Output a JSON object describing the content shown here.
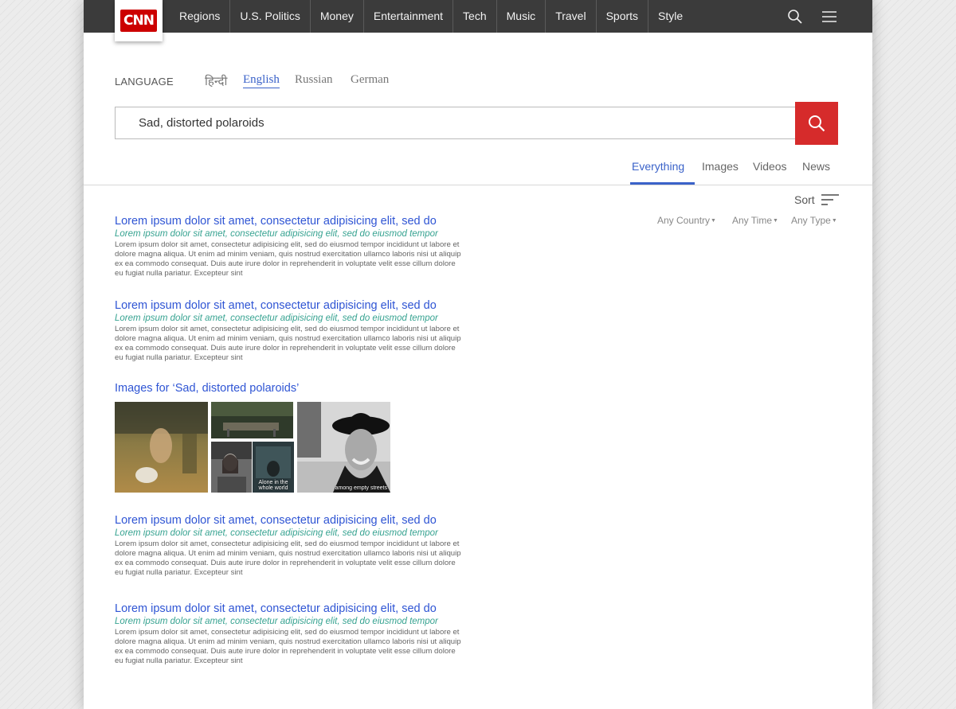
{
  "nav": {
    "logo_text": "CNN",
    "items": [
      "Regions",
      "U.S. Politics",
      "Money",
      "Entertainment",
      "Tech",
      "Music",
      "Travel",
      "Sports",
      "Style"
    ]
  },
  "language": {
    "label": "LANGUAGE",
    "options": [
      "हिन्दी",
      "English",
      "Russian",
      "German"
    ],
    "selected": "English"
  },
  "search": {
    "value": "Sad, distorted polaroids"
  },
  "tabs": {
    "items": [
      "Everything",
      "Images",
      "Videos",
      "News"
    ],
    "active": "Everything"
  },
  "sort": {
    "label": "Sort",
    "filters": [
      "Any Country",
      "Any Time",
      "Any Type"
    ]
  },
  "results": [
    {
      "title": "Lorem ipsum dolor sit amet, consectetur adipisicing elit, sed do",
      "subtitle": "Lorem ipsum dolor sit amet, consectetur adipisicing elit, sed do eiusmod tempor",
      "body": "Lorem ipsum dolor sit amet, consectetur adipisicing elit, sed do eiusmod tempor incididunt ut labore et dolore magna aliqua. Ut enim ad minim veniam, quis nostrud exercitation ullamco laboris nisi ut aliquip ex ea commodo consequat. Duis aute irure dolor in reprehenderit in voluptate velit esse cillum dolore eu fugiat nulla pariatur. Excepteur sint"
    },
    {
      "title": "Lorem ipsum dolor sit amet, consectetur adipisicing elit, sed do",
      "subtitle": "Lorem ipsum dolor sit amet, consectetur adipisicing elit, sed do eiusmod tempor",
      "body": "Lorem ipsum dolor sit amet, consectetur adipisicing elit, sed do eiusmod tempor incididunt ut labore et dolore magna aliqua. Ut enim ad minim veniam, quis nostrud exercitation ullamco laboris nisi ut aliquip ex ea commodo consequat. Duis aute irure dolor in reprehenderit in voluptate velit esse cillum dolore eu fugiat nulla pariatur. Excepteur sint"
    },
    {
      "title": "Lorem ipsum dolor sit amet, consectetur adipisicing elit, sed do",
      "subtitle": "Lorem ipsum dolor sit amet, consectetur adipisicing elit, sed do eiusmod tempor",
      "body": "Lorem ipsum dolor sit amet, consectetur adipisicing elit, sed do eiusmod tempor incididunt ut labore et dolore magna aliqua. Ut enim ad minim veniam, quis nostrud exercitation ullamco laboris nisi ut aliquip ex ea commodo consequat. Duis aute irure dolor in reprehenderit in voluptate velit esse cillum dolore eu fugiat nulla pariatur. Excepteur sint"
    },
    {
      "title": "Lorem ipsum dolor sit amet, consectetur adipisicing elit, sed do",
      "subtitle": "Lorem ipsum dolor sit amet, consectetur adipisicing elit, sed do eiusmod tempor",
      "body": "Lorem ipsum dolor sit amet, consectetur adipisicing elit, sed do eiusmod tempor incididunt ut labore et dolore magna aliqua. Ut enim ad minim veniam, quis nostrud exercitation ullamco laboris nisi ut aliquip ex ea commodo consequat. Duis aute irure dolor in reprehenderit in voluptate velit esse cillum dolore eu fugiat nulla pariatur. Excepteur sint"
    }
  ],
  "images_section": {
    "title": "Images for ‘Sad, distorted polaroids’",
    "thumbnails": [
      {
        "caption": ""
      },
      {
        "caption": ""
      },
      {
        "caption": ""
      },
      {
        "caption": "Alone in the whole world"
      },
      {
        "caption": "among empty streets"
      }
    ]
  },
  "colors": {
    "nav_bg": "#3b3b3b",
    "brand_red": "#cc0000",
    "search_button": "#d62b2b",
    "link_blue": "#2f55d4",
    "accent_blue": "#3a62c9",
    "subtitle_teal": "#37a391"
  },
  "icons": {
    "search": "search-icon",
    "menu": "hamburger-menu-icon",
    "sort": "sort-icon",
    "caret": "caret-down-icon"
  }
}
